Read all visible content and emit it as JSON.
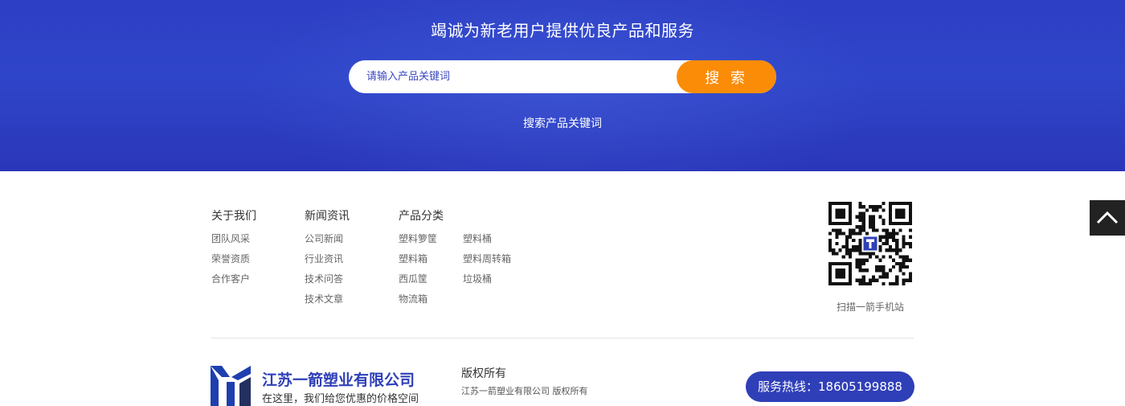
{
  "banner": {
    "title": "竭诚为新老用户提供优良产品和服务",
    "search_placeholder": "请输入产品关键词",
    "search_button": "搜 索",
    "hot_keywords": "搜索产品关键词"
  },
  "footer_nav": {
    "about": {
      "title": "关于我们",
      "links": [
        "团队风采",
        "荣誉资质",
        "合作客户"
      ]
    },
    "news": {
      "title": "新闻资讯",
      "links": [
        "公司新闻",
        "行业资讯",
        "技术问答",
        "技术文章"
      ]
    },
    "products": {
      "title": "产品分类",
      "links_col1": [
        "塑料箩筐",
        "塑料箱",
        "西瓜筐",
        "物流箱"
      ],
      "links_col2": [
        "塑料桶",
        "塑料周转箱",
        "垃圾桶"
      ]
    }
  },
  "qr": {
    "caption": "扫描一箭手机站"
  },
  "company": {
    "name": "江苏一箭塑业有限公司",
    "slogan": "在这里，我们给您优惠的价格空间",
    "copyright_title": "版权所有",
    "copyright_text": "江苏一箭塑业有限公司 版权所有",
    "hotline": "服务热线：18605199888"
  },
  "colors": {
    "banner_blue": "#2f45c9",
    "search_orange": "#fb8c07",
    "brand_blue": "#2f40b8"
  },
  "icons": {
    "back_top": "chevron-up-icon",
    "qr": "qr-code-icon",
    "logo": "company-logo-icon"
  }
}
